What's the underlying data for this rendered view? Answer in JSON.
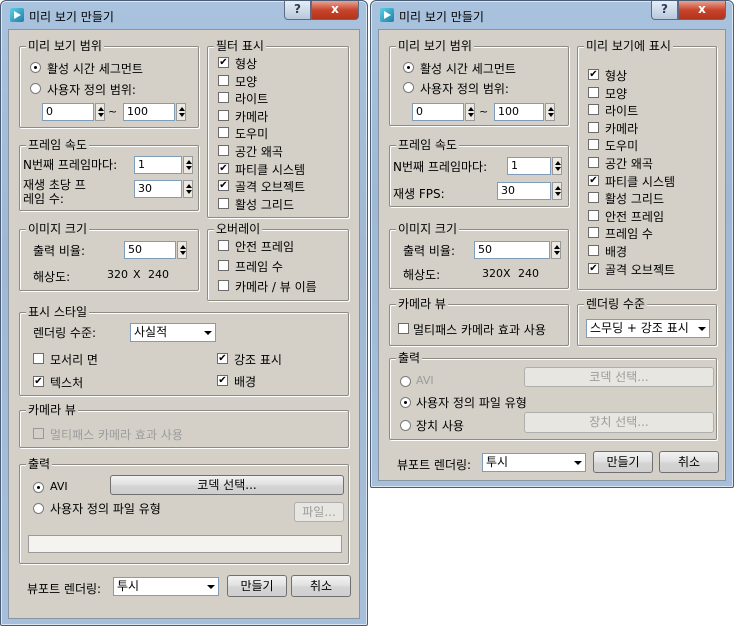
{
  "left": {
    "title": "미리 보기 만들기",
    "range": {
      "title": "미리 보기 범위",
      "active_segment": "활성 시간 세그먼트",
      "custom_range": "사용자 정의 범위:",
      "from": "0",
      "to": "100",
      "tilde": "~"
    },
    "filter": {
      "title": "필터 표시",
      "items": [
        {
          "label": "형상",
          "checked": true
        },
        {
          "label": "모양",
          "checked": false
        },
        {
          "label": "라이트",
          "checked": false
        },
        {
          "label": "카메라",
          "checked": false
        },
        {
          "label": "도우미",
          "checked": false
        },
        {
          "label": "공간 왜곡",
          "checked": false
        },
        {
          "label": "파티클 시스템",
          "checked": true
        },
        {
          "label": "골격 오브젝트",
          "checked": true
        },
        {
          "label": "활성 그리드",
          "checked": false
        }
      ]
    },
    "frame_rate": {
      "title": "프레임 속도",
      "nth_label": "N번째 프레임마다:",
      "nth_value": "1",
      "fps_label_1": "재생 초당 프",
      "fps_label_2": "레임 수:",
      "fps_value": "30"
    },
    "image_size": {
      "title": "이미지 크기",
      "output_label": "출력 비율:",
      "output_value": "50",
      "res_label": "해상도:",
      "res_w": "320",
      "res_x": "X",
      "res_h": "240"
    },
    "overlay": {
      "title": "오버레이",
      "items": [
        "안전 프레임",
        "프레임 수",
        "카메라 / 뷰 이름"
      ]
    },
    "display_style": {
      "title": "표시 스타일",
      "render_level_label": "렌더링 수준:",
      "render_level_value": "사실적",
      "edged_faces": "모서리 면",
      "highlights": "강조 표시",
      "textures": "텍스처",
      "background": "배경"
    },
    "camera_view": {
      "title": "카메라 뷰",
      "multipass": "멀티패스 카메라 효과 사용"
    },
    "output": {
      "title": "출력",
      "avi": "AVI",
      "codec_button": "코덱 선택...",
      "custom_file": "사용자 정의 파일 유형",
      "file_button": "파일..."
    },
    "viewport_label": "뷰포트 렌더링:",
    "viewport_value": "투시",
    "create_button": "만들기",
    "cancel_button": "취소",
    "help_glyph": "?",
    "close_glyph": "x"
  },
  "right": {
    "title": "미리 보기 만들기",
    "range": {
      "title": "미리 보기 범위",
      "active_segment": "활성 시간 세그먼트",
      "custom_range": "사용자 정의 범위:",
      "from": "0",
      "to": "100",
      "tilde": "~"
    },
    "show": {
      "title": "미리 보기에 표시",
      "items": [
        {
          "label": "형상",
          "checked": true
        },
        {
          "label": "모양",
          "checked": false
        },
        {
          "label": "라이트",
          "checked": false
        },
        {
          "label": "카메라",
          "checked": false
        },
        {
          "label": "도우미",
          "checked": false
        },
        {
          "label": "공간 왜곡",
          "checked": false
        },
        {
          "label": "파티클 시스템",
          "checked": true
        },
        {
          "label": "활성 그리드",
          "checked": false
        },
        {
          "label": "안전 프레임",
          "checked": false
        },
        {
          "label": "프레임 수",
          "checked": false
        },
        {
          "label": "배경",
          "checked": false
        },
        {
          "label": "골격 오브젝트",
          "checked": true
        }
      ]
    },
    "frame_rate": {
      "title": "프레임 속도",
      "nth_label": "N번째 프레임마다:",
      "nth_value": "1",
      "fps_label": "재생 FPS:",
      "fps_value": "30"
    },
    "image_size": {
      "title": "이미지 크기",
      "output_label": "출력 비율:",
      "output_value": "50",
      "res_label": "해상도:",
      "res_w": "320",
      "res_x": "X",
      "res_h": "240"
    },
    "camera_view": {
      "title": "카메라 뷰",
      "multipass": "멀티패스 카메라 효과 사용"
    },
    "render_level": {
      "title": "렌더링 수준",
      "value": "스무딩 + 강조 표시"
    },
    "output": {
      "title": "출력",
      "avi": "AVI",
      "codec_button": "코덱 선택...",
      "custom_file": "사용자 정의 파일 유형",
      "use_device": "장치 사용",
      "device_button": "장치 선택..."
    },
    "viewport_label": "뷰포트 렌더링:",
    "viewport_value": "투시",
    "create_button": "만들기",
    "cancel_button": "취소",
    "help_glyph": "?",
    "close_glyph": "x"
  }
}
